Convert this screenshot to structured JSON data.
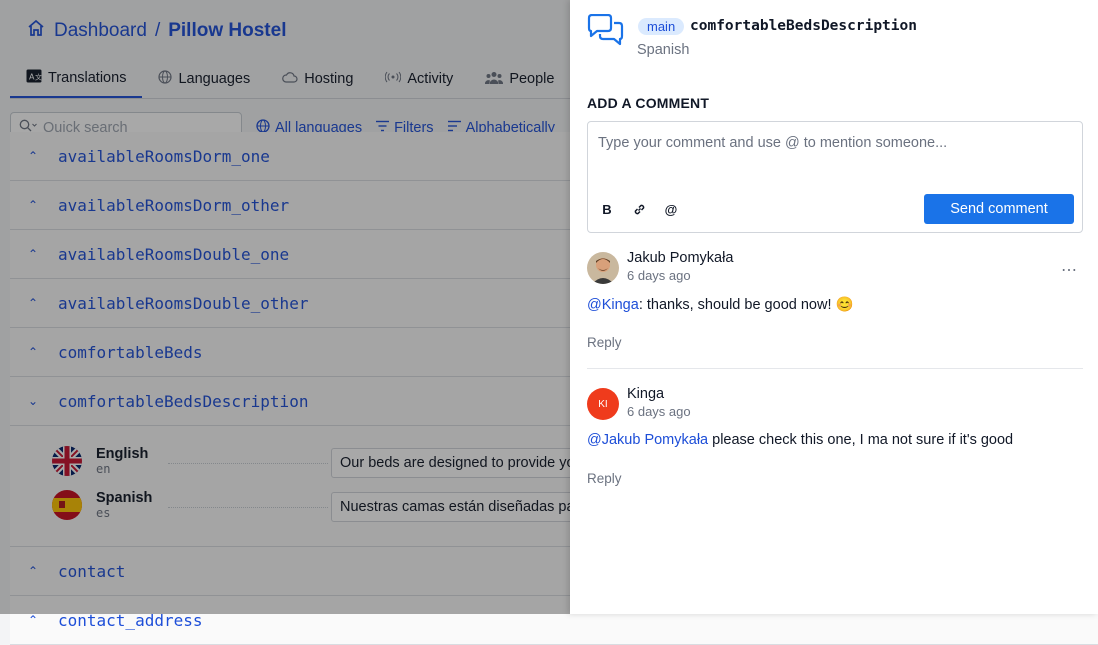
{
  "header": {
    "icon": "home-icon",
    "crumb_root": "Dashboard",
    "crumb_sep": "/",
    "crumb_project": "Pillow Hostel"
  },
  "tabs": [
    {
      "label": "Translations",
      "icon": "translate-icon",
      "active": true
    },
    {
      "label": "Languages",
      "icon": "globe-icon"
    },
    {
      "label": "Hosting",
      "icon": "cloud-icon"
    },
    {
      "label": "Activity",
      "icon": "broadcast-icon"
    },
    {
      "label": "People",
      "icon": "people-icon"
    }
  ],
  "toolbar": {
    "search_placeholder": "Quick search",
    "all_languages": "All languages",
    "filters": "Filters",
    "sort": "Alphabetically"
  },
  "keys": [
    "availableRoomsDorm_one",
    "availableRoomsDorm_other",
    "availableRoomsDouble_one",
    "availableRoomsDouble_other",
    "comfortableBeds",
    "comfortableBedsDescription",
    "contact",
    "contact_address"
  ],
  "expanded": {
    "english": {
      "name": "English",
      "code": "en",
      "value": "Our beds are designed to provide you"
    },
    "spanish": {
      "name": "Spanish",
      "code": "es",
      "value": "Nuestras camas están diseñadas para"
    }
  },
  "panel": {
    "branch": "main",
    "key": "comfortableBedsDescription",
    "language": "Spanish",
    "add_label": "ADD A COMMENT",
    "placeholder": "Type your comment and use @ to mention someone...",
    "send_label": "Send comment",
    "bold_label": "B",
    "mention_label": "@"
  },
  "comments": [
    {
      "author": "Jakub Pomykała",
      "time": "6 days ago",
      "mention": "@Kinga",
      "text": ": thanks, should be good now! 😊",
      "reply": "Reply"
    },
    {
      "author": "Kinga",
      "initials": "KI",
      "time": "6 days ago",
      "mention": "@Jakub Pomykała",
      "text": " please check this one, I ma not sure if it's good",
      "reply": "Reply"
    }
  ]
}
